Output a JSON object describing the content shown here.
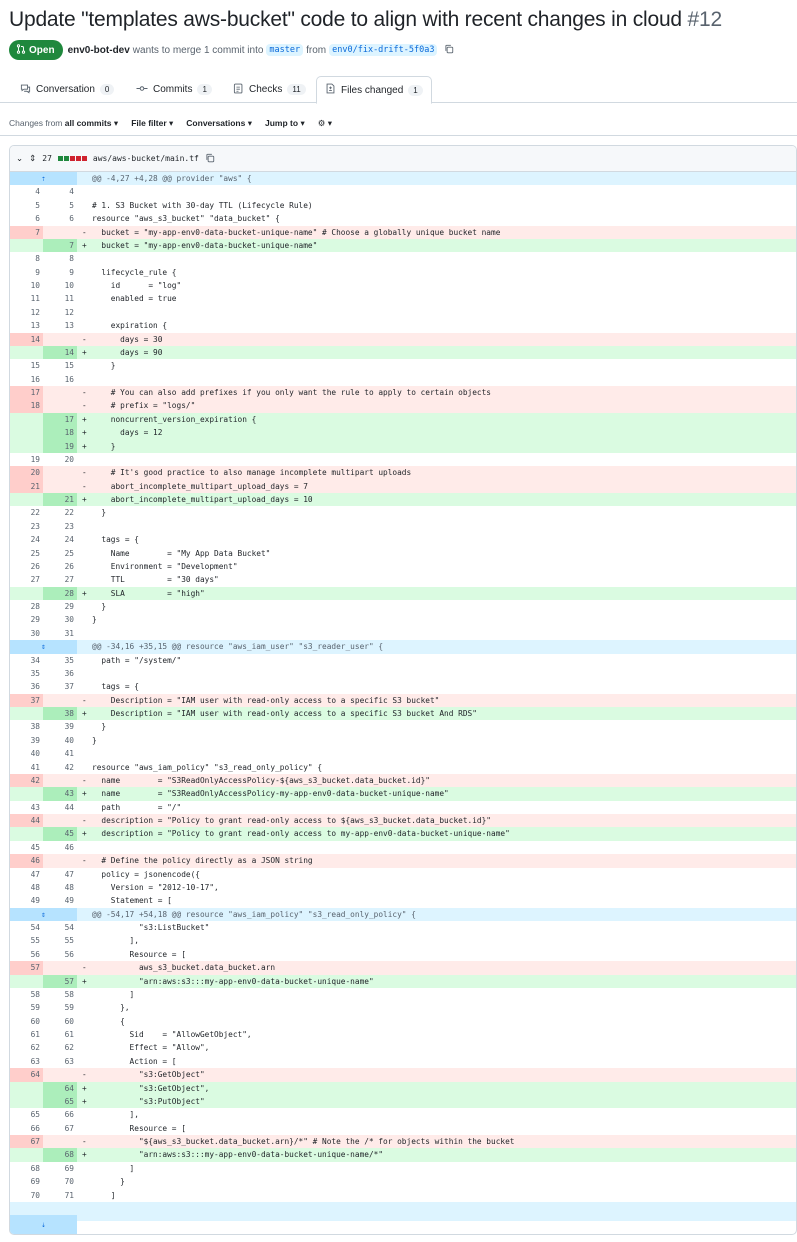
{
  "pr": {
    "title": "Update \"templates aws-bucket\" code to align with recent changes in cloud",
    "number": "#12",
    "status": "Open",
    "author": "env0-bot-dev",
    "merge_text": "wants to merge 1 commit into",
    "base": "master",
    "from_text": "from",
    "head": "env0/fix-drift-5f0a3"
  },
  "tabs": [
    {
      "label": "Conversation",
      "count": "0"
    },
    {
      "label": "Commits",
      "count": "1"
    },
    {
      "label": "Checks",
      "count": "11"
    },
    {
      "label": "Files changed",
      "count": "1"
    }
  ],
  "filters": {
    "changes_prefix": "Changes from",
    "changes_value": "all commits",
    "file_filter": "File filter",
    "conversations": "Conversations",
    "jump_to": "Jump to"
  },
  "file": {
    "changes": "27",
    "path": "aws/aws-bucket/main.tf"
  },
  "colors": {
    "added": "#1f883d",
    "deleted": "#cf222e",
    "accent": "#0969da"
  },
  "diff_lines": [
    {
      "t": "hunk",
      "c": "@@ -4,27 +4,28 @@ provider \"aws\" {",
      "g": "up"
    },
    {
      "t": "ctx",
      "o": "4",
      "n": "4",
      "c": ""
    },
    {
      "t": "ctx",
      "o": "5",
      "n": "5",
      "c": "# 1. S3 Bucket with 30-day TTL (Lifecycle Rule)"
    },
    {
      "t": "ctx",
      "o": "6",
      "n": "6",
      "c": "resource \"aws_s3_bucket\" \"data_bucket\" {"
    },
    {
      "t": "del",
      "o": "7",
      "n": "",
      "c": "  bucket = \"my-app-env0-data-bucket-unique-name\" # Choose a globally unique bucket name"
    },
    {
      "t": "add",
      "o": "",
      "n": "7",
      "c": "  bucket = \"my-app-env0-data-bucket-unique-name\""
    },
    {
      "t": "ctx",
      "o": "8",
      "n": "8",
      "c": ""
    },
    {
      "t": "ctx",
      "o": "9",
      "n": "9",
      "c": "  lifecycle_rule {"
    },
    {
      "t": "ctx",
      "o": "10",
      "n": "10",
      "c": "    id      = \"log\""
    },
    {
      "t": "ctx",
      "o": "11",
      "n": "11",
      "c": "    enabled = true"
    },
    {
      "t": "ctx",
      "o": "12",
      "n": "12",
      "c": ""
    },
    {
      "t": "ctx",
      "o": "13",
      "n": "13",
      "c": "    expiration {"
    },
    {
      "t": "del",
      "o": "14",
      "n": "",
      "c": "      days = 30"
    },
    {
      "t": "add",
      "o": "",
      "n": "14",
      "c": "      days = 90"
    },
    {
      "t": "ctx",
      "o": "15",
      "n": "15",
      "c": "    }"
    },
    {
      "t": "ctx",
      "o": "16",
      "n": "16",
      "c": ""
    },
    {
      "t": "del",
      "o": "17",
      "n": "",
      "c": "    # You can also add prefixes if you only want the rule to apply to certain objects"
    },
    {
      "t": "del",
      "o": "18",
      "n": "",
      "c": "    # prefix = \"logs/\""
    },
    {
      "t": "add",
      "o": "",
      "n": "17",
      "c": "    noncurrent_version_expiration {"
    },
    {
      "t": "add",
      "o": "",
      "n": "18",
      "c": "      days = 12"
    },
    {
      "t": "add",
      "o": "",
      "n": "19",
      "c": "    }"
    },
    {
      "t": "ctx",
      "o": "19",
      "n": "20",
      "c": ""
    },
    {
      "t": "del",
      "o": "20",
      "n": "",
      "c": "    # It's good practice to also manage incomplete multipart uploads"
    },
    {
      "t": "del",
      "o": "21",
      "n": "",
      "c": "    abort_incomplete_multipart_upload_days = 7"
    },
    {
      "t": "add",
      "o": "",
      "n": "21",
      "c": "    abort_incomplete_multipart_upload_days = 10"
    },
    {
      "t": "ctx",
      "o": "22",
      "n": "22",
      "c": "  }"
    },
    {
      "t": "ctx",
      "o": "23",
      "n": "23",
      "c": ""
    },
    {
      "t": "ctx",
      "o": "24",
      "n": "24",
      "c": "  tags = {"
    },
    {
      "t": "ctx",
      "o": "25",
      "n": "25",
      "c": "    Name        = \"My App Data Bucket\""
    },
    {
      "t": "ctx",
      "o": "26",
      "n": "26",
      "c": "    Environment = \"Development\""
    },
    {
      "t": "ctx",
      "o": "27",
      "n": "27",
      "c": "    TTL         = \"30 days\""
    },
    {
      "t": "add",
      "o": "",
      "n": "28",
      "c": "    SLA         = \"high\""
    },
    {
      "t": "ctx",
      "o": "28",
      "n": "29",
      "c": "  }"
    },
    {
      "t": "ctx",
      "o": "29",
      "n": "30",
      "c": "}"
    },
    {
      "t": "ctx",
      "o": "30",
      "n": "31",
      "c": ""
    },
    {
      "t": "hunk",
      "c": "@@ -34,16 +35,15 @@ resource \"aws_iam_user\" \"s3_reader_user\" {",
      "g": "both"
    },
    {
      "t": "ctx",
      "o": "34",
      "n": "35",
      "c": "  path = \"/system/\""
    },
    {
      "t": "ctx",
      "o": "35",
      "n": "36",
      "c": ""
    },
    {
      "t": "ctx",
      "o": "36",
      "n": "37",
      "c": "  tags = {"
    },
    {
      "t": "del",
      "o": "37",
      "n": "",
      "c": "    Description = \"IAM user with read-only access to a specific S3 bucket\""
    },
    {
      "t": "add",
      "o": "",
      "n": "38",
      "c": "    Description = \"IAM user with read-only access to a specific S3 bucket And RDS\""
    },
    {
      "t": "ctx",
      "o": "38",
      "n": "39",
      "c": "  }"
    },
    {
      "t": "ctx",
      "o": "39",
      "n": "40",
      "c": "}"
    },
    {
      "t": "ctx",
      "o": "40",
      "n": "41",
      "c": ""
    },
    {
      "t": "ctx",
      "o": "41",
      "n": "42",
      "c": "resource \"aws_iam_policy\" \"s3_read_only_policy\" {"
    },
    {
      "t": "del",
      "o": "42",
      "n": "",
      "c": "  name        = \"S3ReadOnlyAccessPolicy-${aws_s3_bucket.data_bucket.id}\""
    },
    {
      "t": "add",
      "o": "",
      "n": "43",
      "c": "  name        = \"S3ReadOnlyAccessPolicy-my-app-env0-data-bucket-unique-name\""
    },
    {
      "t": "ctx",
      "o": "43",
      "n": "44",
      "c": "  path        = \"/\""
    },
    {
      "t": "del",
      "o": "44",
      "n": "",
      "c": "  description = \"Policy to grant read-only access to ${aws_s3_bucket.data_bucket.id}\""
    },
    {
      "t": "add",
      "o": "",
      "n": "45",
      "c": "  description = \"Policy to grant read-only access to my-app-env0-data-bucket-unique-name\""
    },
    {
      "t": "ctx",
      "o": "45",
      "n": "46",
      "c": ""
    },
    {
      "t": "del",
      "o": "46",
      "n": "",
      "c": "  # Define the policy directly as a JSON string"
    },
    {
      "t": "ctx",
      "o": "47",
      "n": "47",
      "c": "  policy = jsonencode({"
    },
    {
      "t": "ctx",
      "o": "48",
      "n": "48",
      "c": "    Version = \"2012-10-17\","
    },
    {
      "t": "ctx",
      "o": "49",
      "n": "49",
      "c": "    Statement = ["
    },
    {
      "t": "hunk",
      "c": "@@ -54,17 +54,18 @@ resource \"aws_iam_policy\" \"s3_read_only_policy\" {",
      "g": "both"
    },
    {
      "t": "ctx",
      "o": "54",
      "n": "54",
      "c": "          \"s3:ListBucket\""
    },
    {
      "t": "ctx",
      "o": "55",
      "n": "55",
      "c": "        ],"
    },
    {
      "t": "ctx",
      "o": "56",
      "n": "56",
      "c": "        Resource = ["
    },
    {
      "t": "del",
      "o": "57",
      "n": "",
      "c": "          aws_s3_bucket.data_bucket.arn"
    },
    {
      "t": "add",
      "o": "",
      "n": "57",
      "c": "          \"arn:aws:s3:::my-app-env0-data-bucket-unique-name\""
    },
    {
      "t": "ctx",
      "o": "58",
      "n": "58",
      "c": "        ]"
    },
    {
      "t": "ctx",
      "o": "59",
      "n": "59",
      "c": "      },"
    },
    {
      "t": "ctx",
      "o": "60",
      "n": "60",
      "c": "      {"
    },
    {
      "t": "ctx",
      "o": "61",
      "n": "61",
      "c": "        Sid    = \"AllowGetObject\","
    },
    {
      "t": "ctx",
      "o": "62",
      "n": "62",
      "c": "        Effect = \"Allow\","
    },
    {
      "t": "ctx",
      "o": "63",
      "n": "63",
      "c": "        Action = ["
    },
    {
      "t": "del",
      "o": "64",
      "n": "",
      "c": "          \"s3:GetObject\""
    },
    {
      "t": "add",
      "o": "",
      "n": "64",
      "c": "          \"s3:GetObject\","
    },
    {
      "t": "add",
      "o": "",
      "n": "65",
      "c": "          \"s3:PutObject\""
    },
    {
      "t": "ctx",
      "o": "65",
      "n": "66",
      "c": "        ],"
    },
    {
      "t": "ctx",
      "o": "66",
      "n": "67",
      "c": "        Resource = ["
    },
    {
      "t": "del",
      "o": "67",
      "n": "",
      "c": "          \"${aws_s3_bucket.data_bucket.arn}/*\" # Note the /* for objects within the bucket"
    },
    {
      "t": "add",
      "o": "",
      "n": "68",
      "c": "          \"arn:aws:s3:::my-app-env0-data-bucket-unique-name/*\""
    },
    {
      "t": "ctx",
      "o": "68",
      "n": "69",
      "c": "        ]"
    },
    {
      "t": "ctx",
      "o": "69",
      "n": "70",
      "c": "      }"
    },
    {
      "t": "ctx",
      "o": "70",
      "n": "71",
      "c": "    ]"
    }
  ]
}
